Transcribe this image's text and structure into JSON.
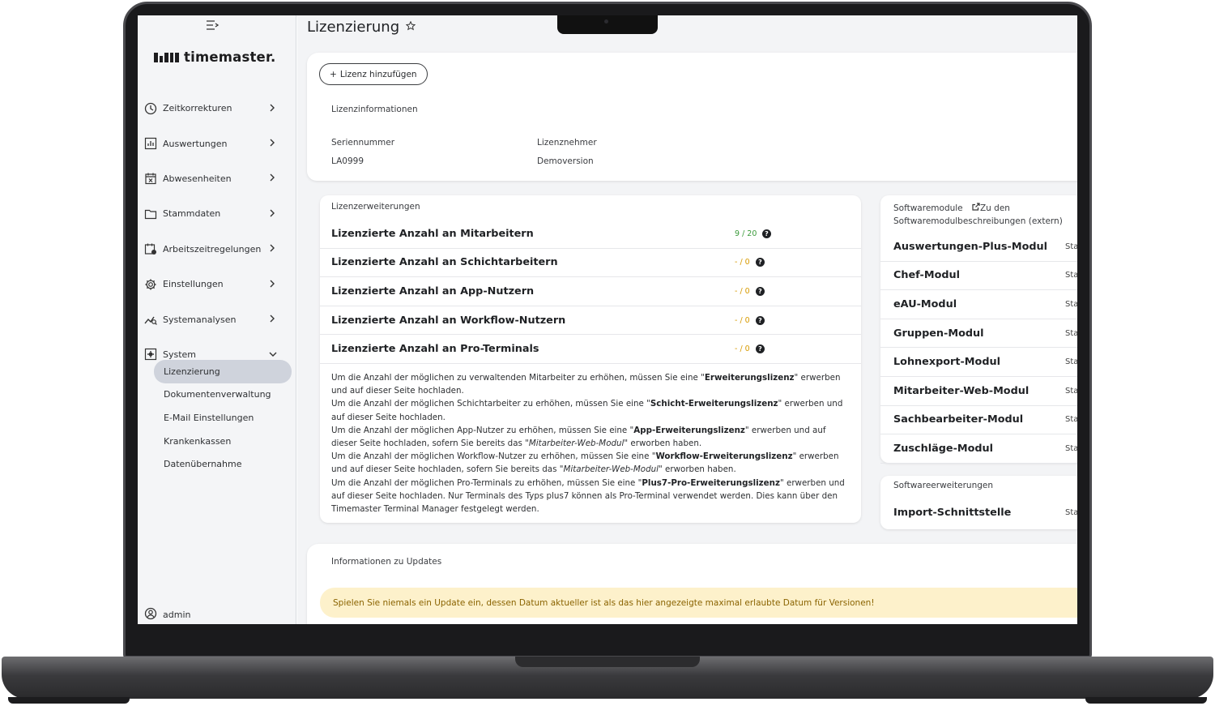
{
  "app": {
    "brand": "timemaster.",
    "page_title": "Lizenzierung"
  },
  "sidebar": {
    "items": [
      {
        "label": "Zeitkorrekturen",
        "icon": "clock-icon"
      },
      {
        "label": "Auswertungen",
        "icon": "chart-icon"
      },
      {
        "label": "Abwesenheiten",
        "icon": "calendar-x-icon"
      },
      {
        "label": "Stammdaten",
        "icon": "folder-icon"
      },
      {
        "label": "Arbeitszeitregelungen",
        "icon": "calendar-clock-icon"
      },
      {
        "label": "Einstellungen",
        "icon": "gear-icon"
      },
      {
        "label": "Systemanalysen",
        "icon": "analytics-icon"
      },
      {
        "label": "System",
        "icon": "system-icon"
      }
    ],
    "sub_items": [
      {
        "label": "Lizenzierung",
        "active": true
      },
      {
        "label": "Dokumentenverwaltung"
      },
      {
        "label": "E-Mail Einstellungen"
      },
      {
        "label": "Krankenkassen"
      },
      {
        "label": "Datenübernahme"
      }
    ],
    "user": "admin"
  },
  "license_info": {
    "add_button": "Lizenz hinzufügen",
    "section_title": "Lizenzinformationen",
    "serial_label": "Seriennummer",
    "serial_value": "LA0999",
    "licensee_label": "Lizenznehmer",
    "licensee_value": "Demoversion"
  },
  "extensions": {
    "section_title": "Lizenzerweiterungen",
    "rows": [
      {
        "name": "Lizenzierte Anzahl an Mitarbeitern",
        "count": "9 / 20",
        "color": "#3a9a3a"
      },
      {
        "name": "Lizenzierte Anzahl an Schichtarbeitern",
        "count": "- / 0",
        "color": "#d79a00"
      },
      {
        "name": "Lizenzierte Anzahl an App-Nutzern",
        "count": "- / 0",
        "color": "#d79a00"
      },
      {
        "name": "Lizenzierte Anzahl an Workflow-Nutzern",
        "count": "- / 0",
        "color": "#d79a00"
      },
      {
        "name": "Lizenzierte Anzahl an Pro-Terminals",
        "count": "- / 0",
        "color": "#d79a00"
      }
    ],
    "text": {
      "p1a": "Um die Anzahl der möglichen zu verwaltenden Mitarbeiter zu erhöhen, müssen Sie eine \"",
      "p1b": "Erweiterungslizenz",
      "p1c": "\" erwerben und auf dieser Seite hochladen.",
      "p2a": "Um die Anzahl der möglichen Schichtarbeiter zu erhöhen, müssen Sie eine \"",
      "p2b": "Schicht-Erweiterungslizenz",
      "p2c": "\" erwerben und auf dieser Seite hochladen.",
      "p3a": "Um die Anzahl der möglichen App-Nutzer zu erhöhen, müssen Sie eine \"",
      "p3b": "App-Erweiterungslizenz",
      "p3c": "\" erwerben und auf dieser Seite hochladen, sofern Sie bereits das \"",
      "p3d": "Mitarbeiter-Web-Modul",
      "p3e": "\" erworben haben.",
      "p4a": "Um die Anzahl der möglichen Workflow-Nutzer zu erhöhen, müssen Sie eine \"",
      "p4b": "Workflow-Erweiterungslizenz",
      "p4c": "\" erwerben und auf dieser Seite hochladen, sofern Sie bereits das \"",
      "p4d": "Mitarbeiter-Web-Modul",
      "p4e": "\" erworben haben.",
      "p5a": "Um die Anzahl der möglichen Pro-Terminals zu erhöhen, müssen Sie eine \"",
      "p5b": "Plus7-Pro-Erweiterungslizenz",
      "p5c": "\" erwerben und auf dieser Seite hochladen. Nur Terminals des Typs plus7 können als Pro-Terminal verwendet werden. Dies kann über den Timemaster Terminal Manager festgelegt werden."
    }
  },
  "modules": {
    "section_title": "Softwaremodule",
    "link_label": "Zu den Softwaremodulbeschreibungen (extern)",
    "items": [
      {
        "name": "Auswertungen-Plus-Modul",
        "status": "Sta"
      },
      {
        "name": "Chef-Modul",
        "status": "Sta"
      },
      {
        "name": "eAU-Modul",
        "status": "Sta"
      },
      {
        "name": "Gruppen-Modul",
        "status": "Sta"
      },
      {
        "name": "Lohnexport-Modul",
        "status": "Sta"
      },
      {
        "name": "Mitarbeiter-Web-Modul",
        "status": "Sta"
      },
      {
        "name": "Sachbearbeiter-Modul",
        "status": "Sta"
      },
      {
        "name": "Zuschläge-Modul",
        "status": "Sta"
      }
    ]
  },
  "software_ext": {
    "section_title": "Softwareerweiterungen",
    "items": [
      {
        "name": "Import-Schnittstelle",
        "status": "Sta"
      }
    ]
  },
  "updates": {
    "section_title": "Informationen zu Updates",
    "warning": "Spielen Sie niemals ein Update ein, dessen Datum aktueller ist als das hier angezeigte maximal erlaubte Datum für Versionen!"
  }
}
